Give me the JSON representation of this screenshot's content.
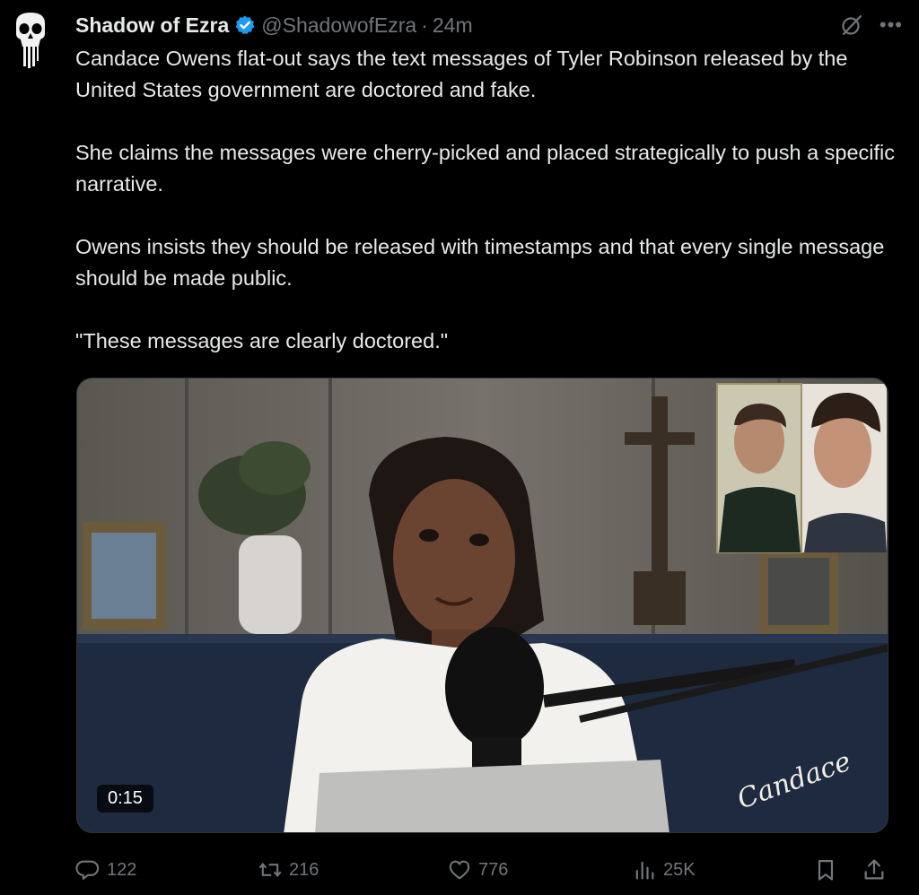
{
  "tweet": {
    "display_name": "Shadow of Ezra",
    "handle": "@ShadowofEzra",
    "separator": "·",
    "time": "24m",
    "paragraphs": [
      "Candace Owens flat-out says the text messages of Tyler Robinson released by the United States government are doctored and fake.",
      "She claims the messages were cherry-picked and placed strategically to push a specific narrative.",
      "Owens insists they should be released with timestamps and that every single message should be made public.",
      "\"These messages are clearly doctored.\""
    ]
  },
  "video": {
    "duration": "0:15",
    "watermark": "Candace"
  },
  "actions": {
    "replies": "122",
    "reposts": "216",
    "likes": "776",
    "views": "25K"
  },
  "icons": {
    "avatar": "skull-avatar-icon",
    "verified": "verified-badge-icon",
    "grok": "grok-icon",
    "more": "more-icon",
    "reply": "reply-icon",
    "repost": "repost-icon",
    "like": "heart-icon",
    "views": "views-icon",
    "bookmark": "bookmark-icon",
    "share": "share-icon"
  },
  "colors": {
    "background": "#000000",
    "text": "#e7e9ea",
    "secondary": "#71767b",
    "verified": "#1d9bf0"
  }
}
